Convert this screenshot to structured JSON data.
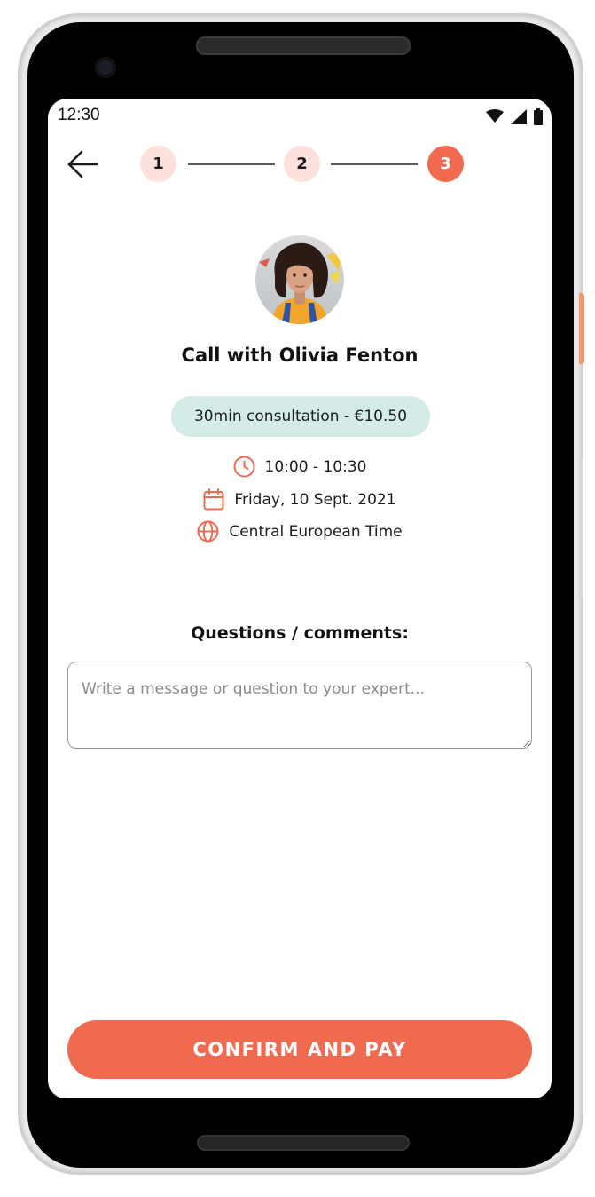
{
  "status_bar": {
    "time": "12:30"
  },
  "stepper": {
    "steps": [
      "1",
      "2",
      "3"
    ],
    "current_step": 3
  },
  "expert": {
    "call_title": "Call with Olivia Fenton"
  },
  "booking": {
    "consultation_label": "30min consultation - €10.50",
    "time_range": "10:00 - 10:30",
    "date": "Friday, 10 Sept. 2021",
    "timezone": "Central European Time"
  },
  "questions": {
    "label": "Questions / comments:",
    "placeholder": "Write a message or question to your expert...",
    "value": ""
  },
  "actions": {
    "confirm_label": "CONFIRM AND PAY"
  },
  "colors": {
    "accent": "#f06a4f",
    "step_done_bg": "#fde1dc",
    "chip_bg": "#d4ece7"
  }
}
